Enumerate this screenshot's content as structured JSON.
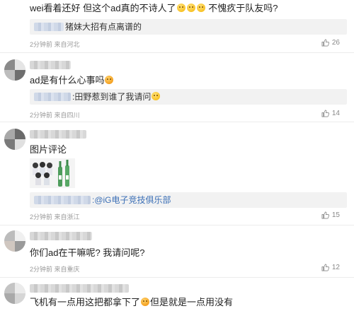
{
  "comments": [
    {
      "text_parts": [
        "wei看着还好 但这个ad真的不诗人了",
        "不愧疚于队友吗?"
      ],
      "reply_name": "",
      "reply_text": "猪妹大招有点离谱的",
      "meta": "2分钟前 来自河北",
      "likes": "26"
    },
    {
      "text_parts": [
        "ad是有什么心事吗",
        ""
      ],
      "reply_name": "",
      "reply_text": ":田野惹到谁了我请问",
      "meta": "2分钟前 来自四川",
      "likes": "14"
    },
    {
      "text_parts": [
        "图片评论",
        ""
      ],
      "reply_name": "",
      "reply_text": ":@iG电子竞技俱乐部",
      "meta": "2分钟前 来自浙江",
      "likes": "15"
    },
    {
      "text_parts": [
        "你们ad在干嘛呢? 我请问呢?",
        ""
      ],
      "reply_name": "",
      "reply_text": "",
      "meta": "2分钟前 来自重庆",
      "likes": "12"
    },
    {
      "text_parts": [
        "飞机有一点用这把都拿下了",
        "但是就是一点用没有"
      ],
      "reply_name": "",
      "reply_text": "",
      "meta": "",
      "likes": ""
    }
  ],
  "icons": {
    "like": "thumbs-up-icon",
    "emoji": "smiley-emoji",
    "more": "chevron-down-icon"
  },
  "colors": {
    "link": "#3b6fb6",
    "meta": "#999999",
    "reply_bg": "#f2f2f2"
  }
}
